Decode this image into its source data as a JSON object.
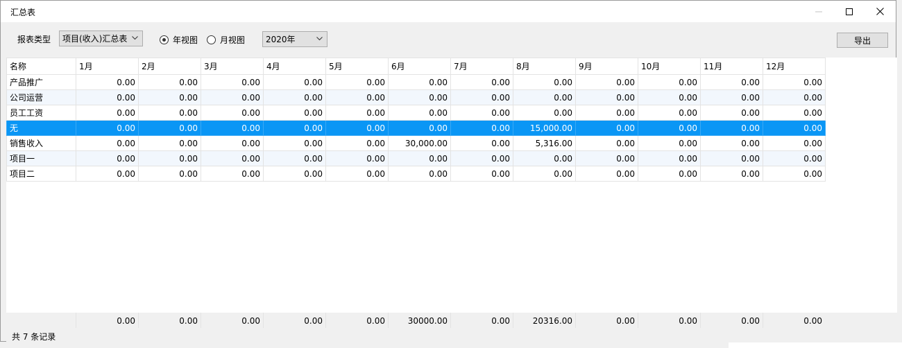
{
  "window": {
    "title": "汇总表"
  },
  "toolbar": {
    "report_type_label": "报表类型",
    "report_type_value": "项目(收入)汇总表",
    "view_year_label": "年视图",
    "view_month_label": "月视图",
    "year_value": "2020年",
    "export_label": "导出"
  },
  "table": {
    "headers": [
      "名称",
      "1月",
      "2月",
      "3月",
      "4月",
      "5月",
      "6月",
      "7月",
      "8月",
      "9月",
      "10月",
      "11月",
      "12月"
    ],
    "rows": [
      {
        "name": "产品推广",
        "values": [
          "0.00",
          "0.00",
          "0.00",
          "0.00",
          "0.00",
          "0.00",
          "0.00",
          "0.00",
          "0.00",
          "0.00",
          "0.00",
          "0.00"
        ]
      },
      {
        "name": "公司运营",
        "values": [
          "0.00",
          "0.00",
          "0.00",
          "0.00",
          "0.00",
          "0.00",
          "0.00",
          "0.00",
          "0.00",
          "0.00",
          "0.00",
          "0.00"
        ]
      },
      {
        "name": "员工工资",
        "values": [
          "0.00",
          "0.00",
          "0.00",
          "0.00",
          "0.00",
          "0.00",
          "0.00",
          "0.00",
          "0.00",
          "0.00",
          "0.00",
          "0.00"
        ]
      },
      {
        "name": "无",
        "values": [
          "0.00",
          "0.00",
          "0.00",
          "0.00",
          "0.00",
          "0.00",
          "0.00",
          "15,000.00",
          "0.00",
          "0.00",
          "0.00",
          "0.00"
        ]
      },
      {
        "name": "销售收入",
        "values": [
          "0.00",
          "0.00",
          "0.00",
          "0.00",
          "0.00",
          "30,000.00",
          "0.00",
          "5,316.00",
          "0.00",
          "0.00",
          "0.00",
          "0.00"
        ]
      },
      {
        "name": "项目一",
        "values": [
          "0.00",
          "0.00",
          "0.00",
          "0.00",
          "0.00",
          "0.00",
          "0.00",
          "0.00",
          "0.00",
          "0.00",
          "0.00",
          "0.00"
        ]
      },
      {
        "name": "项目二",
        "values": [
          "0.00",
          "0.00",
          "0.00",
          "0.00",
          "0.00",
          "0.00",
          "0.00",
          "0.00",
          "0.00",
          "0.00",
          "0.00",
          "0.00"
        ]
      }
    ],
    "totals": [
      "0.00",
      "0.00",
      "0.00",
      "0.00",
      "0.00",
      "30000.00",
      "0.00",
      "20316.00",
      "0.00",
      "0.00",
      "0.00",
      "0.00"
    ]
  },
  "status": {
    "text": "共 7 条记录"
  },
  "colors": {
    "selected_row": "#0a96f5",
    "alt_row": "#f2f7fd"
  }
}
